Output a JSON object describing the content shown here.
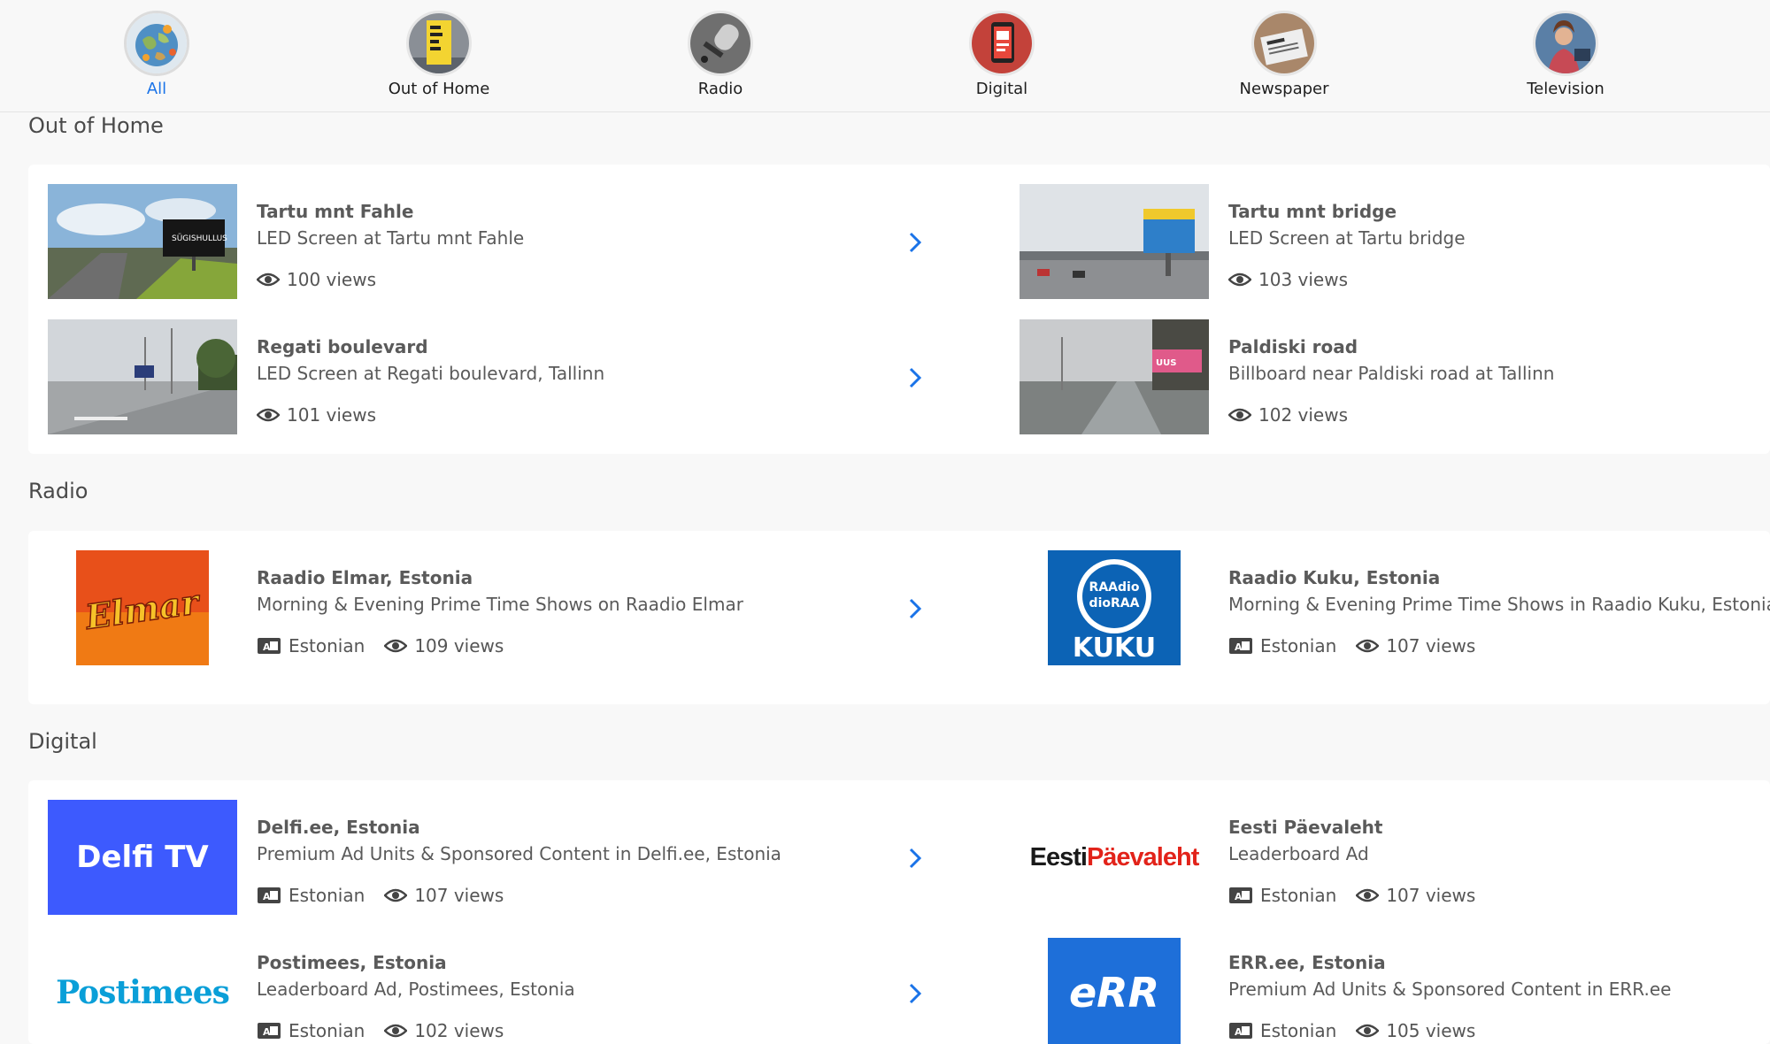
{
  "categories": [
    {
      "label": "All",
      "icon": "globe-icon",
      "active": true
    },
    {
      "label": "Out of Home",
      "icon": "advertising-poster-icon",
      "active": false
    },
    {
      "label": "Radio",
      "icon": "microphone-icon",
      "active": false
    },
    {
      "label": "Digital",
      "icon": "smartphone-icon",
      "active": false
    },
    {
      "label": "Newspaper",
      "icon": "newspaper-icon",
      "active": false
    },
    {
      "label": "Television",
      "icon": "tv-presenter-icon",
      "active": false
    }
  ],
  "sections": {
    "ooh": {
      "title": "Out of Home",
      "items": [
        {
          "title": "Tartu mnt Fahle",
          "subtitle": "LED Screen at Tartu mnt Fahle",
          "views": "100 views",
          "thumb_text": "SÜGISHULLUS"
        },
        {
          "title": "Tartu mnt bridge",
          "subtitle": "LED Screen at Tartu bridge",
          "views": "103 views",
          "thumb_text": ""
        },
        {
          "title": "Regati boulevard",
          "subtitle": "LED Screen at Regati boulevard, Tallinn",
          "views": "101 views",
          "thumb_text": ""
        },
        {
          "title": "Paldiski road",
          "subtitle": "Billboard near Paldiski road at Tallinn",
          "views": "102 views",
          "thumb_text": "UUS"
        }
      ]
    },
    "radio": {
      "title": "Radio",
      "items": [
        {
          "title": "Raadio Elmar, Estonia",
          "subtitle": "Morning & Evening Prime Time Shows on Raadio Elmar",
          "language": "Estonian",
          "views": "109 views",
          "logo_text": "Elmar"
        },
        {
          "title": "Raadio Kuku, Estonia",
          "subtitle": "Morning & Evening Prime Time Shows in Raadio Kuku, Estonia",
          "language": "Estonian",
          "views": "107 views",
          "logo_text": "KUKU"
        }
      ]
    },
    "digital": {
      "title": "Digital",
      "items": [
        {
          "title": "Delfi.ee, Estonia",
          "subtitle": "Premium Ad Units & Sponsored Content in Delfi.ee, Estonia",
          "language": "Estonian",
          "views": "107 views",
          "logo_text": "Delfi TV"
        },
        {
          "title": "Eesti Päevaleht",
          "subtitle": "Leaderboard Ad",
          "language": "Estonian",
          "views": "107 views",
          "logo_text_a": "Eesti",
          "logo_text_b": "Päevaleht"
        },
        {
          "title": "Postimees, Estonia",
          "subtitle": "Leaderboard Ad, Postimees, Estonia",
          "language": "Estonian",
          "views": "102 views",
          "logo_text": "Postimees"
        },
        {
          "title": "ERR.ee, Estonia",
          "subtitle": "Premium Ad Units & Sponsored Content in ERR.ee",
          "language": "Estonian",
          "views": "105 views",
          "logo_text": "eRR"
        }
      ]
    }
  },
  "colors": {
    "accent": "#1a73e8",
    "chevron": "#1a73e8",
    "delfi": "#3d5afe",
    "err": "#1e6fd9",
    "postimees": "#0a9fd8",
    "paevaleht_red": "#e2231a",
    "kuku": "#0c63b5",
    "elmar": "#e8501a"
  }
}
